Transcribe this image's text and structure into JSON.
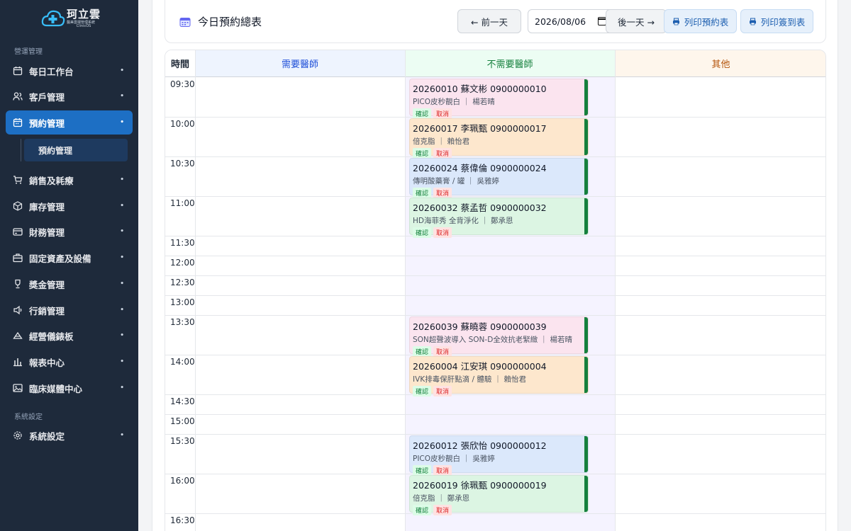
{
  "brand": {
    "name": "珂立雲",
    "subtitle": "醫美雲端管理系統",
    "product": "ClinicOS",
    "accent": "#1d6fc4"
  },
  "sidebar": {
    "section1": "營運管理",
    "section2": "系統設定",
    "items": [
      {
        "label": "每日工作台",
        "icon": "calendar-icon"
      },
      {
        "label": "客戶管理",
        "icon": "users-icon"
      },
      {
        "label": "預約管理",
        "icon": "calendar-check-icon",
        "active": true
      },
      {
        "label": "銷售及耗療",
        "icon": "cart-icon"
      },
      {
        "label": "庫存管理",
        "icon": "box-icon"
      },
      {
        "label": "財務管理",
        "icon": "wallet-icon"
      },
      {
        "label": "固定資產及設備",
        "icon": "briefcase-icon"
      },
      {
        "label": "獎金管理",
        "icon": "trophy-icon"
      },
      {
        "label": "行銷管理",
        "icon": "megaphone-icon"
      },
      {
        "label": "經營儀錶板",
        "icon": "gauge-icon"
      },
      {
        "label": "報表中心",
        "icon": "bar-chart-icon"
      },
      {
        "label": "臨床媒體中心",
        "icon": "image-icon"
      },
      {
        "label": "系統設定",
        "icon": "gear-icon"
      }
    ],
    "sub_item": "預約管理"
  },
  "header": {
    "title": "今日預約總表",
    "prev_label": "← 前一天",
    "date_value": "2026/08/06",
    "next_label": "後一天 →",
    "print_schedule_label": "列印預約表",
    "print_checkin_label": "列印簽到表"
  },
  "schedule": {
    "columns": [
      {
        "label": "時間",
        "color": "#1f2937"
      },
      {
        "label": "需要醫師",
        "color": "#1d4ed8"
      },
      {
        "label": "不需要醫師",
        "color": "#15803d"
      },
      {
        "label": "其他",
        "color": "#b45309"
      }
    ],
    "times": [
      "09:30",
      "10:00",
      "10:30",
      "11:00",
      "11:30",
      "12:00",
      "12:30",
      "13:00",
      "13:30",
      "14:00",
      "14:30",
      "15:00",
      "15:30",
      "16:00",
      "16:30"
    ],
    "appointments": [
      {
        "title": "20260010 蘇文彬 0900000010",
        "detail": "PICO皮秒靚白 ｜ 楊若晴",
        "color": "pink"
      },
      {
        "title": "20260017 李珮甄 0900000017",
        "detail": "倍克脂 ｜ 賴怡君",
        "color": "orange"
      },
      {
        "title": "20260024 蔡偉倫 0900000024",
        "detail": "傳明酸藥膏 / 罐 ｜ 吳雅婷",
        "color": "blue"
      },
      {
        "title": "20260032 蔡孟哲 0900000032",
        "detail": "HD海菲秀 全背淨化 ｜ 鄭承恩",
        "color": "green"
      },
      {
        "title": "20260039 蘇曉蓉 0900000039",
        "detail": "SON超聲波導入 SON-D全效抗老緊緻 ｜ 楊若晴",
        "color": "pink"
      },
      {
        "title": "20260004 江安琪 0900000004",
        "detail": "IVK排毒保肝點滴 / 體驗 ｜ 賴怡君",
        "color": "orange"
      },
      {
        "title": "20260012 張欣怡 0900000012",
        "detail": "PICO皮秒靚白 ｜ 吳雅婷",
        "color": "blue"
      },
      {
        "title": "20260019 徐珮甄 0900000019",
        "detail": "倍克脂 ｜ 鄭承恩",
        "color": "green"
      }
    ],
    "confirm_label": "確認",
    "cancel_label": "取消"
  }
}
